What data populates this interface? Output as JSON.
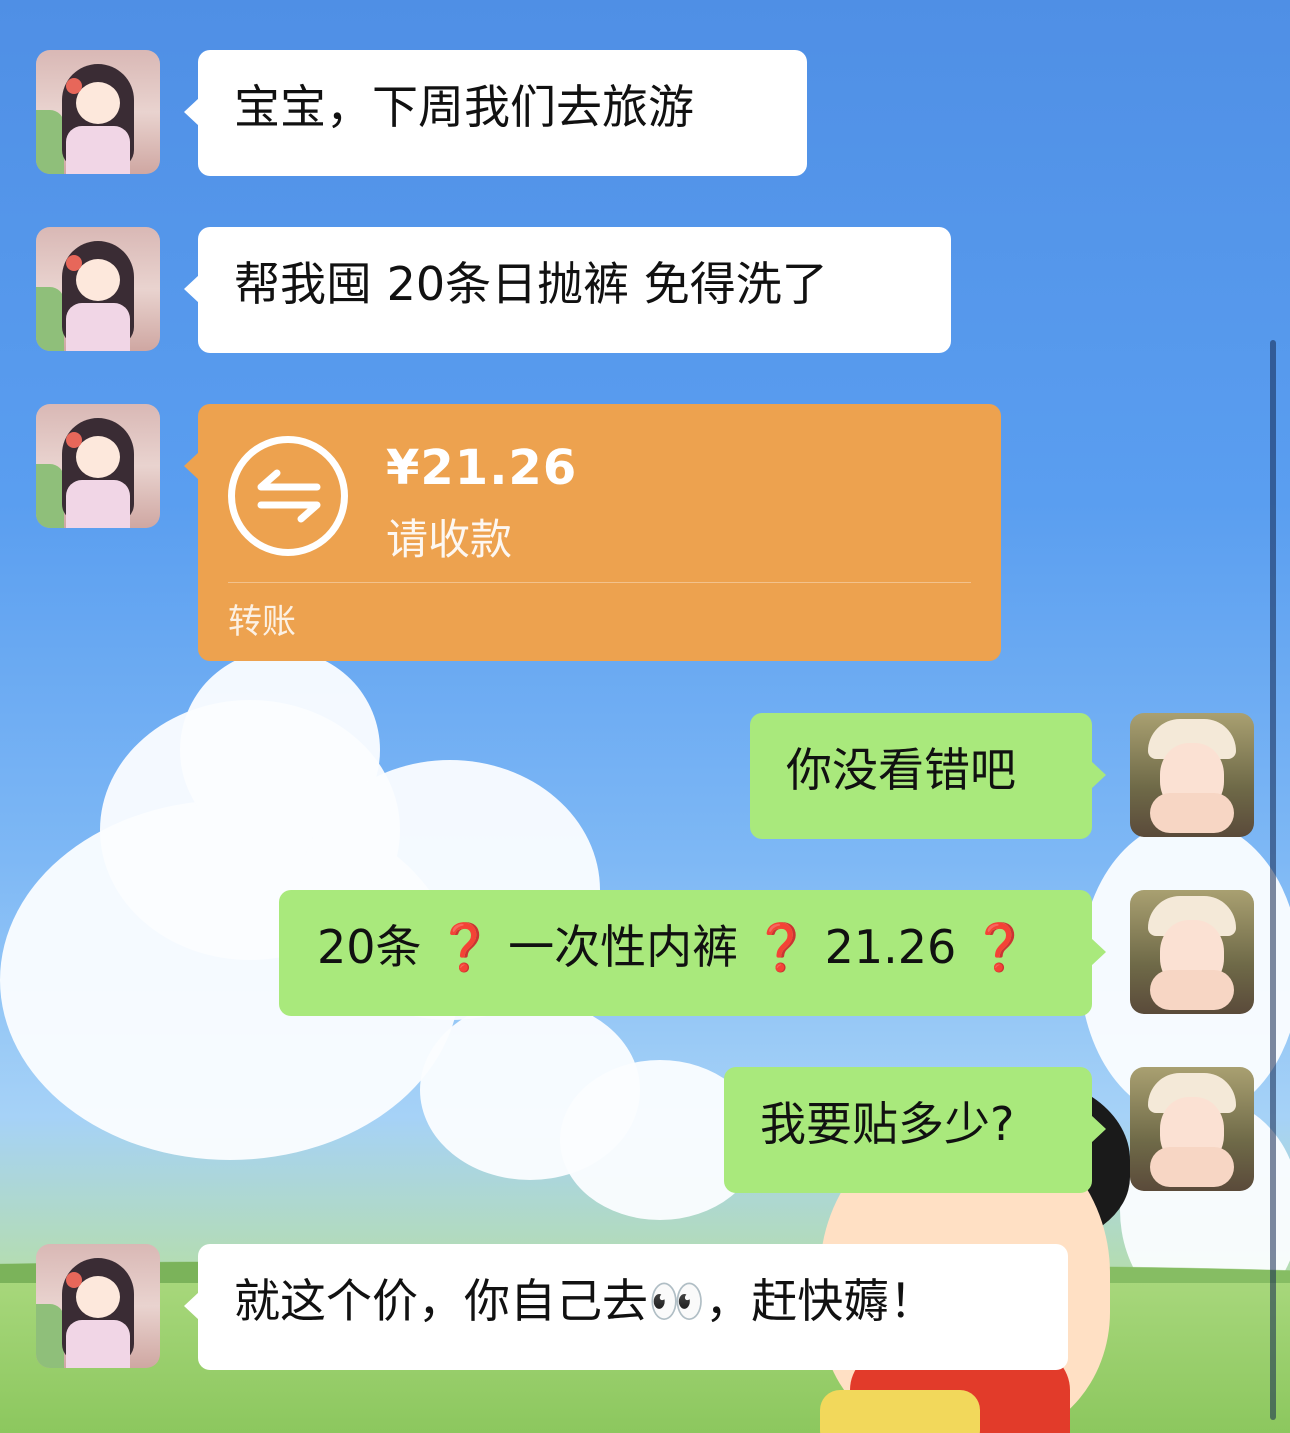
{
  "chat": {
    "messages": [
      {
        "side": "left",
        "type": "text",
        "text": "宝宝，下周我们去旅游"
      },
      {
        "side": "left",
        "type": "text",
        "text": "帮我囤 20条日抛裤 免得洗了"
      },
      {
        "side": "left",
        "type": "transfer",
        "amount": "¥21.26",
        "status": "请收款",
        "label": "转账"
      },
      {
        "side": "right",
        "type": "text",
        "text": "你没看错吧"
      },
      {
        "side": "right",
        "type": "text",
        "parts": [
          "20条",
          "❓",
          "一次性内裤",
          "❓",
          "21.26",
          "❓"
        ]
      },
      {
        "side": "right",
        "type": "text",
        "text": "我要贴多少?"
      },
      {
        "side": "left",
        "type": "text",
        "parts": [
          "就这个价，你自己去",
          "👀",
          "，赶快薅！"
        ]
      }
    ]
  },
  "colors": {
    "bubble_left": "#ffffff",
    "bubble_right": "#a9e97c",
    "transfer": "#eda24f",
    "question_mark": "#e0352b"
  },
  "icons": {
    "transfer_icon": "arrows-exchange-icon",
    "avatar_left": "cartoon-girl-avatar",
    "avatar_right": "child-photo-avatar"
  }
}
